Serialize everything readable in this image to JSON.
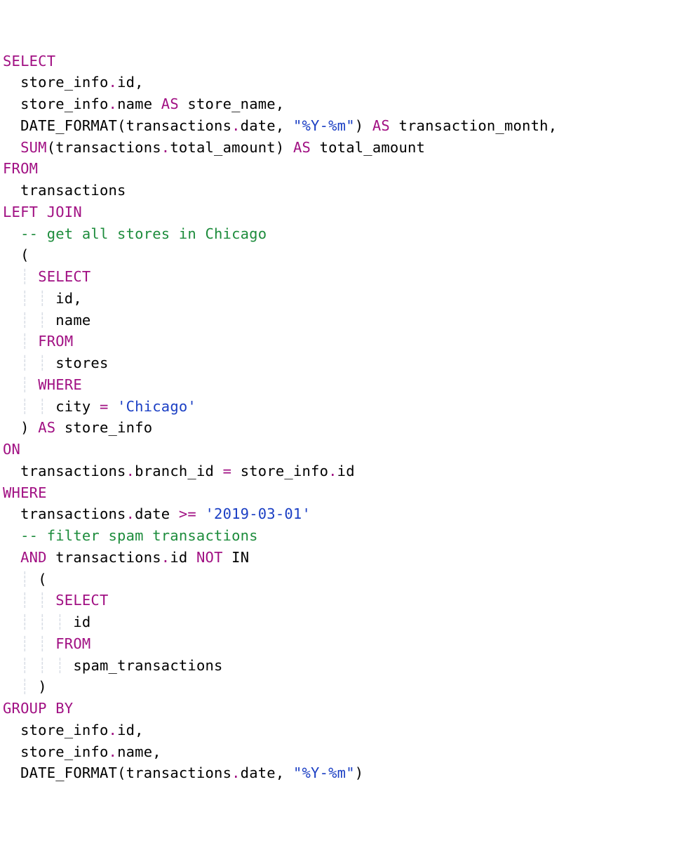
{
  "tokens": {
    "SELECT": "SELECT",
    "FROM": "FROM",
    "WHERE": "WHERE",
    "AS": "AS",
    "SUM": "SUM",
    "LEFT_JOIN": "LEFT JOIN",
    "ON": "ON",
    "AND": "AND",
    "NOT": "NOT",
    "IN": "IN",
    "GROUP_BY": "GROUP BY",
    "DATE_FORMAT": "DATE_FORMAT"
  },
  "ids": {
    "store_info": "store_info",
    "id": "id",
    "name": "name",
    "store_name": "store_name",
    "transactions": "transactions",
    "date": "date",
    "transaction_month": "transaction_month",
    "total_amount": "total_amount",
    "stores": "stores",
    "city": "city",
    "branch_id": "branch_id",
    "spam_transactions": "spam_transactions"
  },
  "str": {
    "ym": "\"%Y-%m\"",
    "chicago": "'Chicago'",
    "date1": "'2019-03-01'"
  },
  "cmt": {
    "chicago": "-- get all stores in Chicago",
    "spam": "-- filter spam transactions"
  },
  "op": {
    "eq": "=",
    "ge": ">="
  }
}
